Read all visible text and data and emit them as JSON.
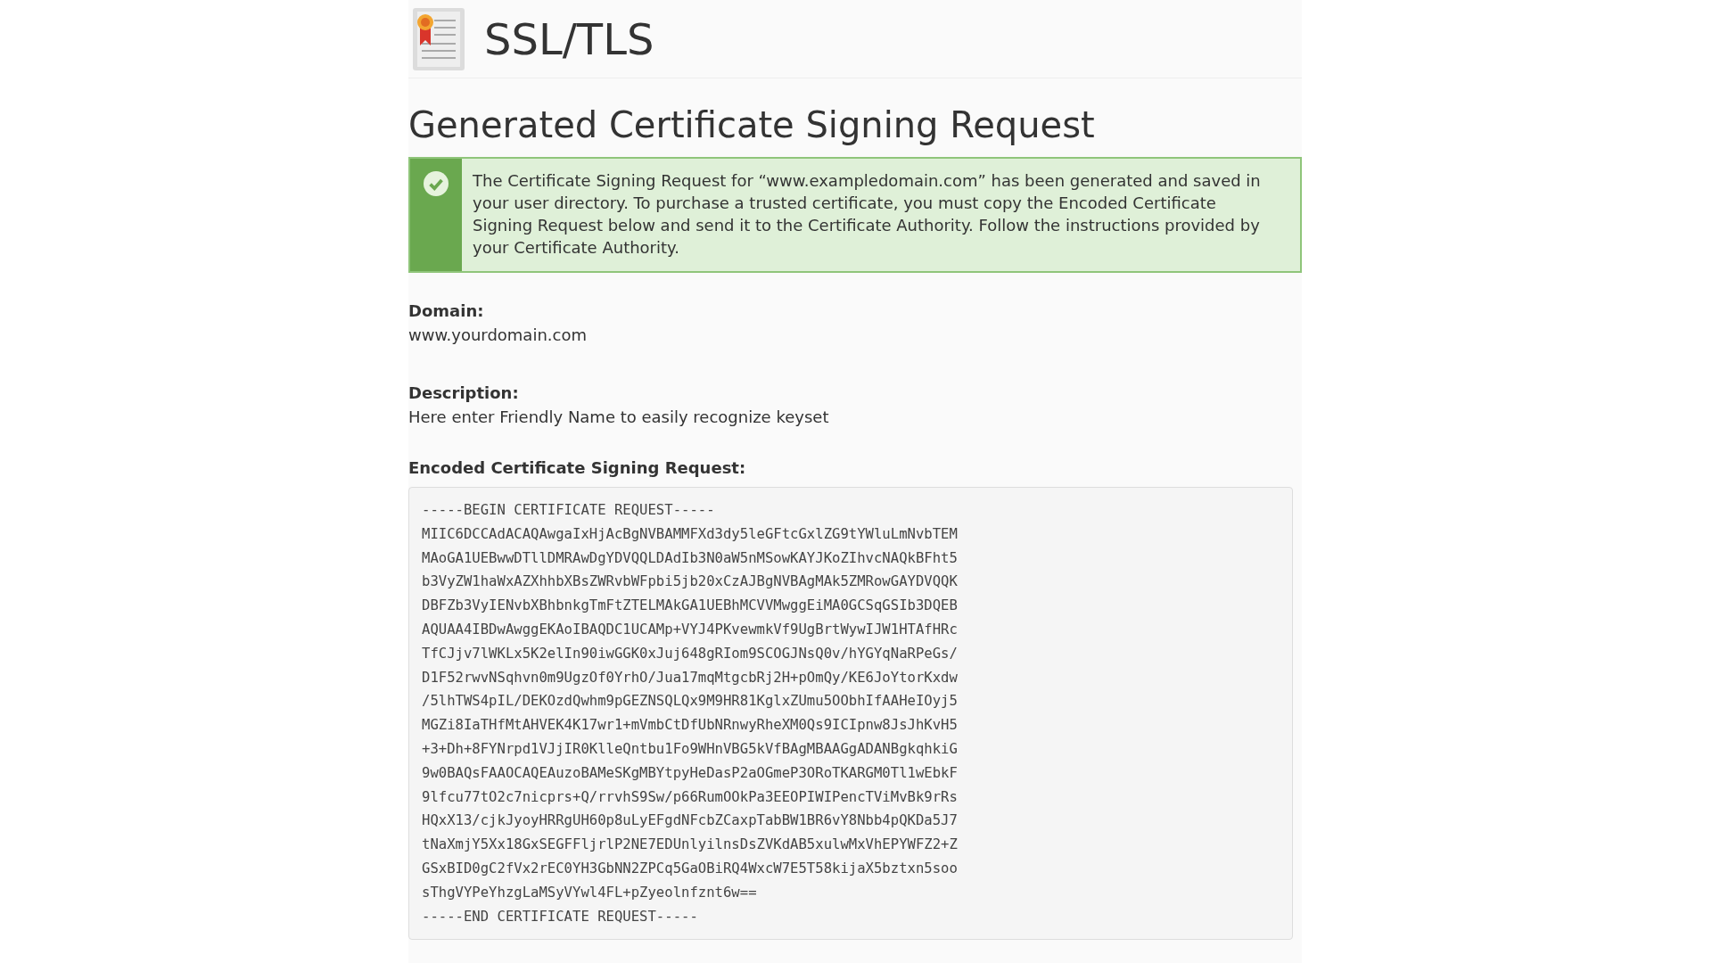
{
  "header": {
    "title": "SSL/TLS"
  },
  "heading": "Generated Certificate Signing Request",
  "alert": {
    "kind": "success",
    "message": "The Certificate Signing Request for “www.exampledomain.com” has been generated and saved in your user directory. To purchase a trusted certificate, you must copy the Encoded Certificate Signing Request below and send it to the Certificate Authority. Follow the instructions provided by your Certificate Authority."
  },
  "fields": [
    {
      "label": "Domain:",
      "value": "www.yourdomain.com"
    },
    {
      "label": "Description:",
      "value": "Here enter Friendly Name to easily recognize keyset"
    }
  ],
  "csr": {
    "label": "Encoded Certificate Signing Request:",
    "lines": [
      "-----BEGIN CERTIFICATE REQUEST-----",
      "MIIC6DCCAdACAQAwgaIxHjAcBgNVBAMMFXd3dy5leGFtcGxlZG9tYWluLmNvbTEM",
      "MAoGA1UEBwwDTllDMRAwDgYDVQQLDAdIb3N0aW5nMSowKAYJKoZIhvcNAQkBFht5",
      "b3VyZW1haWxAZXhhbXBsZWRvbWFpbi5jb20xCzAJBgNVBAgMAk5ZMRowGAYDVQQK",
      "DBFZb3VyIENvbXBhbnkgTmFtZTELMAkGA1UEBhMCVVMwggEiMA0GCSqGSIb3DQEB",
      "AQUAA4IBDwAwggEKAoIBAQDC1UCAMp+VYJ4PKvewmkVf9UgBrtWywIJW1HTAfHRc",
      "TfCJjv7lWKLx5K2elIn90iwGGK0xJuj648gRIom9SCOGJNsQ0v/hYGYqNaRPeGs/",
      "D1F52rwvNSqhvn0m9UgzOf0YrhO/Jua17mqMtgcbRj2H+pOmQy/KE6JoYtorKxdw",
      "/5lhTWS4pIL/DEKOzdQwhm9pGEZNSQLQx9M9HR81KglxZUmu5OObhIfAAHeIOyj5",
      "MGZi8IaTHfMtAHVEK4K17wr1+mVmbCtDfUbNRnwyRheXM0Qs9ICIpnw8JsJhKvH5",
      "+3+Dh+8FYNrpd1VJjIR0KlleQntbu1Fo9WHnVBG5kVfBAgMBAAGgADANBgkqhkiG",
      "9w0BAQsFAAOCAQEAuzoBAMeSKgMBYtpyHeDasP2aOGmeP3ORoTKARGM0Tl1wEbkF",
      "9lfcu77tO2c7nicprs+Q/rrvhS9Sw/p66RumOOkPa3EEOPIWIPencTViMvBk9rRs",
      "HQxX13/cjkJyoyHRRgUH60p8uLyEFgdNFcbZCaxpTabBW1BR6vY8Nbb4pQKDa5J7",
      "tNaXmjY5Xx18GxSEGFFljrlP2NE7EDUnlyilnsDsZVKdAB5xulwMxVhEPYWFZ2+Z",
      "GSxBID0gC2fVx2rEC0YH3GbNN2ZPCq5GaOBiRQ4WxcW7E5T58kijaX5bztxn5soo",
      "sThgVYPeYhzgLaMSyVYwl4FL+pZyeolnfznt6w==",
      "-----END CERTIFICATE REQUEST-----"
    ]
  }
}
